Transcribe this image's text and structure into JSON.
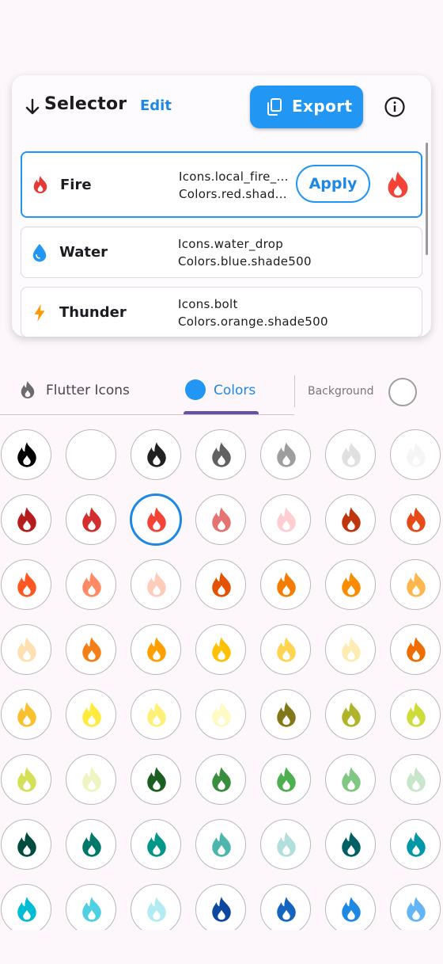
{
  "header": {
    "title": "Selector",
    "edit_label": "Edit",
    "export_label": "Export"
  },
  "items": [
    {
      "name": "Fire",
      "icon": "local-fire-icon",
      "color": "#e53935",
      "icon_code": "Icons.local_fire_...",
      "color_code": "Colors.red.shad...",
      "selected": true,
      "apply_label": "Apply"
    },
    {
      "name": "Water",
      "icon": "water-drop-icon",
      "color": "#2196f3",
      "icon_code": "Icons.water_drop",
      "color_code": "Colors.blue.shade500"
    },
    {
      "name": "Thunder",
      "icon": "bolt-icon",
      "color": "#ff9800",
      "icon_code": "Icons.bolt",
      "color_code": "Colors.orange.shade500"
    }
  ],
  "tabs": [
    {
      "label": "Flutter Icons",
      "active": false
    },
    {
      "label": "Colors",
      "active": true
    }
  ],
  "background_label": "Background",
  "swatches": [
    [
      "#000000",
      "#ffffff",
      "#212121",
      "#616161",
      "#9e9e9e",
      "#e0e0e0",
      "#f5f5f5"
    ],
    [
      "#b71c1c",
      "#d32f2f",
      "#f44336",
      "#e57373",
      "#ffcdd2",
      "#bf360c",
      "#e64a19"
    ],
    [
      "#ff5722",
      "#ff8a65",
      "#ffccbc",
      "#e65100",
      "#f57c00",
      "#fb8c00",
      "#ffb74d"
    ],
    [
      "#ffe0b2",
      "#f57f17",
      "#ffa000",
      "#ffc107",
      "#ffd54f",
      "#ffecb3",
      "#ef6c00"
    ],
    [
      "#fbc02d",
      "#ffeb3b",
      "#fff176",
      "#fff9c4",
      "#827717",
      "#afb42b",
      "#cddc39"
    ],
    [
      "#d4e157",
      "#f0f4c3",
      "#1b5e20",
      "#388e3c",
      "#4caf50",
      "#81c784",
      "#c8e6c9"
    ],
    [
      "#004d40",
      "#00796b",
      "#009688",
      "#4db6ac",
      "#b2dfdb",
      "#006064",
      "#0097a7"
    ],
    [
      "#00bcd4",
      "#4dd0e1",
      "#b2ebf2",
      "#0d47a1",
      "#1565c0",
      "#1e88e5",
      "#64b5f6"
    ]
  ],
  "selected_swatch": [
    1,
    2
  ]
}
